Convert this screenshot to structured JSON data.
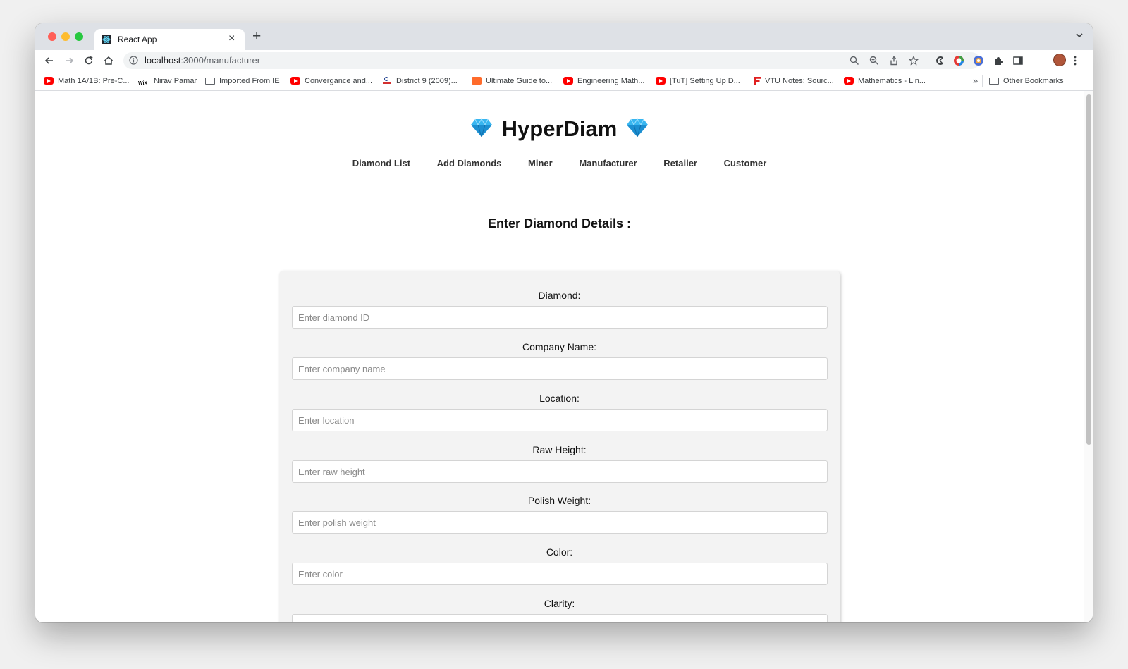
{
  "browser": {
    "tab_title": "React App",
    "url_host": "localhost",
    "url_rest": ":3000/manufacturer",
    "new_tab_label": "+",
    "tab_close_label": "×",
    "bookmarks": [
      {
        "label": "Math 1A/1B: Pre-C...",
        "icon": "youtube-icon"
      },
      {
        "label": "Nirav Pamar",
        "icon": "wix-icon"
      },
      {
        "label": "Imported From IE",
        "icon": "folder-icon"
      },
      {
        "label": "Convergance and...",
        "icon": "youtube-icon"
      },
      {
        "label": "District 9 (2009)...",
        "icon": "district-icon"
      },
      {
        "label": "Ultimate Guide to...",
        "icon": "ultimate-icon"
      },
      {
        "label": "Engineering Math...",
        "icon": "youtube-icon"
      },
      {
        "label": "[TuT] Setting Up D...",
        "icon": "youtube-icon"
      },
      {
        "label": "VTU Notes: Sourc...",
        "icon": "vtu-icon"
      },
      {
        "label": "Mathematics - Lin...",
        "icon": "youtube-icon"
      }
    ],
    "bookmarks_overflow": "»",
    "other_bookmarks": "Other Bookmarks"
  },
  "app": {
    "brand": "HyperDiam",
    "nav": [
      "Diamond List",
      "Add Diamonds",
      "Miner",
      "Manufacturer",
      "Retailer",
      "Customer"
    ],
    "form_heading": "Enter Diamond Details :",
    "fields": [
      {
        "label": "Diamond:",
        "placeholder": "Enter diamond ID"
      },
      {
        "label": "Company Name:",
        "placeholder": "Enter company name"
      },
      {
        "label": "Location:",
        "placeholder": "Enter location"
      },
      {
        "label": "Raw Height:",
        "placeholder": "Enter raw height"
      },
      {
        "label": "Polish Weight:",
        "placeholder": "Enter polish weight"
      },
      {
        "label": "Color:",
        "placeholder": "Enter color"
      },
      {
        "label": "Clarity:",
        "placeholder": ""
      }
    ]
  },
  "colors": {
    "gem": "#38b6f0",
    "yt_red": "#ff0000",
    "card_bg": "#f3f3f3"
  }
}
